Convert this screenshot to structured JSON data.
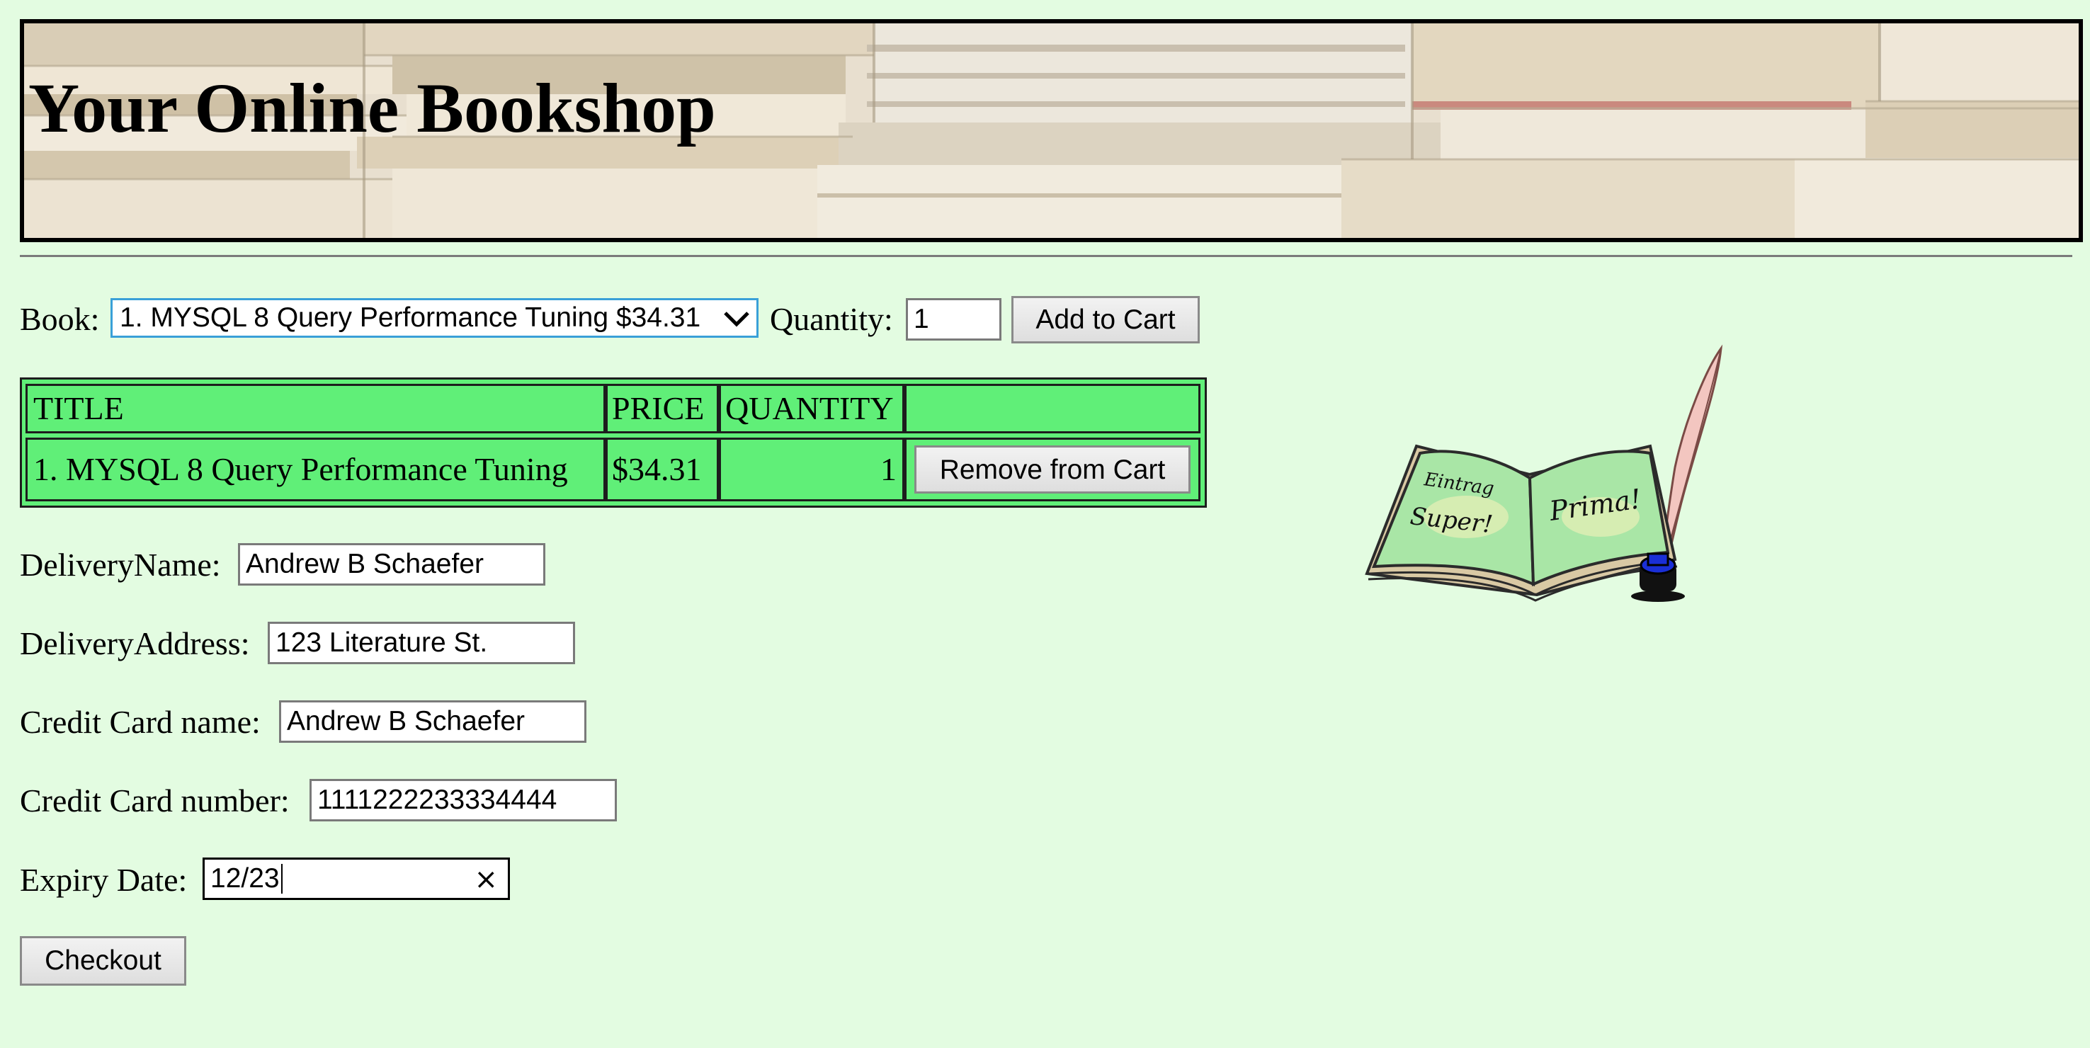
{
  "header": {
    "title": "Your Online Bookshop",
    "banner_image": "stacked-books-photo"
  },
  "order_form": {
    "book_label": "Book:",
    "book_selected": "1. MYSQL 8 Query Performance Tuning $34.31",
    "quantity_label": "Quantity:",
    "quantity_value": "1",
    "add_to_cart_label": "Add to Cart"
  },
  "cart": {
    "headers": [
      "TITLE",
      "PRICE",
      "QUANTITY",
      ""
    ],
    "rows": [
      {
        "title": "1. MYSQL 8 Query Performance Tuning",
        "price": "$34.31",
        "quantity": "1",
        "action_label": "Remove from Cart"
      }
    ],
    "row_color": "#60ef78"
  },
  "delivery": {
    "name_label": "DeliveryName:",
    "name_value": "Andrew B Schaefer",
    "address_label": "DeliveryAddress:",
    "address_value": "123 Literature St.",
    "cc_name_label": "Credit Card name:",
    "cc_name_value": "Andrew B Schaefer",
    "cc_number_label": "Credit Card number:",
    "cc_number_value": "1111222233334444",
    "expiry_label": "Expiry Date:",
    "expiry_value": "12/23",
    "clear_icon": "×"
  },
  "checkout_label": "Checkout",
  "clipart": {
    "icon": "open-book-quill-icon",
    "left_page_top": "Eintrag",
    "left_page_bottom": "Super!",
    "right_page": "Prima!"
  },
  "colors": {
    "background": "#e3fce1",
    "table_green": "#60ef78",
    "select_focus_border": "#3aa0d8"
  }
}
